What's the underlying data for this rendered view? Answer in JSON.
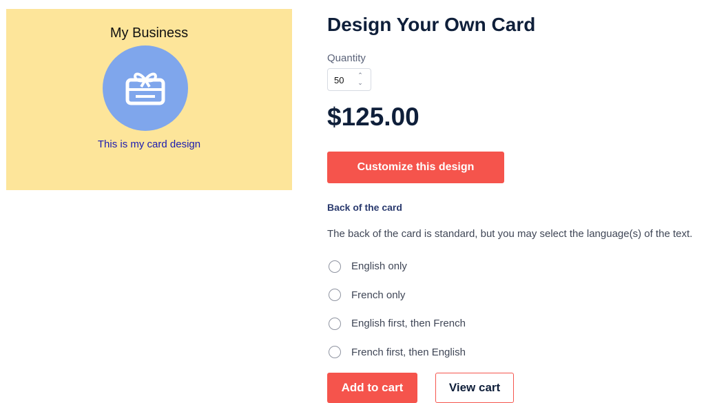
{
  "preview": {
    "business_name": "My Business",
    "icon": "gift-card-icon",
    "caption": "This is my card design",
    "background_color": "#fde59a",
    "circle_color": "#7fa6ec",
    "caption_color": "#1a1ab0"
  },
  "product": {
    "title": "Design Your Own Card",
    "quantity_label": "Quantity",
    "quantity_value": "50",
    "price": "$125.00",
    "customize_label": "Customize this design"
  },
  "back_of_card": {
    "heading": "Back of the card",
    "description": "The back of the card is standard, but you may select the language(s) of the text.",
    "options": [
      {
        "label": "English only"
      },
      {
        "label": "French only"
      },
      {
        "label": "English first, then French"
      },
      {
        "label": "French first, then English"
      }
    ]
  },
  "cart": {
    "add_label": "Add to cart",
    "view_label": "View cart"
  },
  "colors": {
    "accent": "#f5544c",
    "heading": "#0f1f3a",
    "section_heading": "#2a3a6e"
  }
}
